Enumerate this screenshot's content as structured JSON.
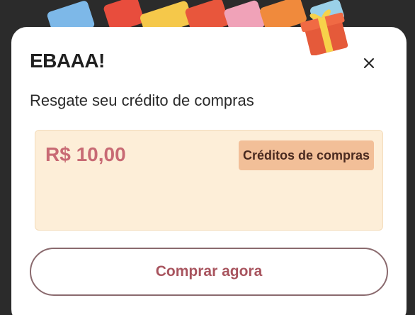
{
  "modal": {
    "title": "EBAAA!",
    "subtitle": "Resgate seu crédito de compras",
    "close_icon": "close-icon"
  },
  "credit": {
    "amount": "R$ 10,00",
    "tag_label": "Créditos de compras"
  },
  "actions": {
    "buy_label": "Comprar agora"
  },
  "colors": {
    "amount": "#c86a74",
    "tag_bg": "#f2bf98",
    "card_bg": "#fdeed8",
    "button_text": "#a8545e"
  }
}
